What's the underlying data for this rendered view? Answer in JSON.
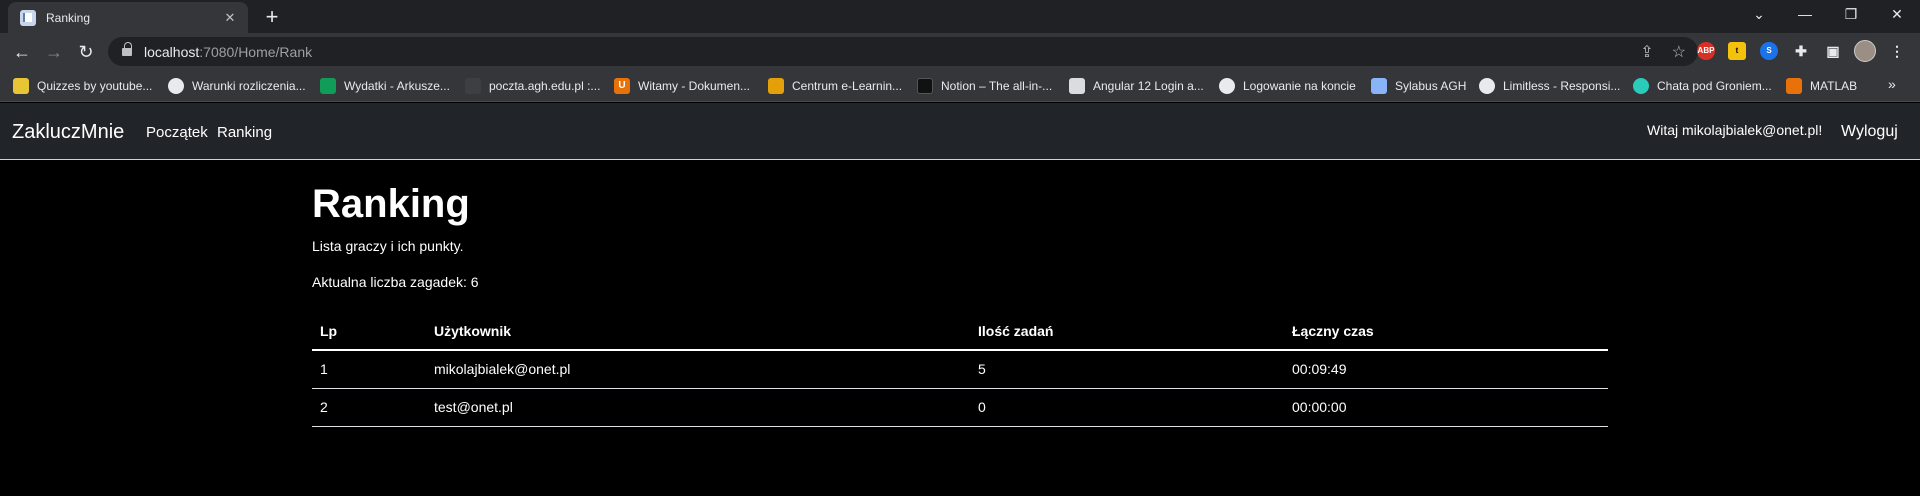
{
  "browser": {
    "tab_title": "Ranking",
    "tab_close": "✕",
    "new_tab": "+",
    "url_host": "localhost",
    "url_rest": ":7080/Home/Rank",
    "extensions": [
      {
        "name": "ABP",
        "color": "#d93025"
      },
      {
        "name": "t",
        "color": "#f4c20d"
      },
      {
        "name": "S",
        "color": "#1a73e8"
      }
    ],
    "bookmarks": [
      {
        "label": "Quizzes by youtube...",
        "icon": "quiz-icon",
        "color": "#e8c534"
      },
      {
        "label": "Warunki rozliczenia...",
        "icon": "cloud-icon",
        "color": "#e8eaed"
      },
      {
        "label": "Wydatki - Arkusze...",
        "icon": "sheets-icon",
        "color": "#0f9d58"
      },
      {
        "label": "poczta.agh.edu.pl :...",
        "icon": "mail-icon",
        "color": "#3c4043"
      },
      {
        "label": "Witamy - Dokumen...",
        "icon": "u-icon",
        "color": "#e8710a"
      },
      {
        "label": "Centrum e-Learnin...",
        "icon": "elearning-icon",
        "color": "#e3a008"
      },
      {
        "label": "Notion – The all-in-...",
        "icon": "notion-icon",
        "color": "#111111"
      },
      {
        "label": "Angular 12 Login a...",
        "icon": "page-icon",
        "color": "#dadce0"
      },
      {
        "label": "Logowanie na koncie",
        "icon": "globe-icon",
        "color": "#e8eaed"
      },
      {
        "label": "Sylabus AGH",
        "icon": "sylabus-icon",
        "color": "#8ab4f8"
      },
      {
        "label": "Limitless - Responsi...",
        "icon": "globe-icon",
        "color": "#e8eaed"
      },
      {
        "label": "Chata pod Groniem...",
        "icon": "owl-icon",
        "color": "#2bcbba"
      },
      {
        "label": "MATLAB",
        "icon": "matlab-icon",
        "color": "#e8710a"
      }
    ]
  },
  "app": {
    "brand": "ZakluczMnie",
    "nav": [
      "Początek",
      "Ranking"
    ],
    "welcome": "Witaj mikolajbialek@onet.pl!",
    "logout": "Wyloguj"
  },
  "page": {
    "title": "Ranking",
    "subtitle": "Lista graczy i ich punkty.",
    "count_label": "Aktualna liczba zagadek: 6"
  },
  "table": {
    "headers": [
      "Lp",
      "Użytkownik",
      "Ilość zadań",
      "Łączny czas"
    ],
    "rows": [
      [
        "1",
        "mikolajbialek@onet.pl",
        "5",
        "00:09:49"
      ],
      [
        "2",
        "test@onet.pl",
        "0",
        "00:00:00"
      ]
    ]
  }
}
